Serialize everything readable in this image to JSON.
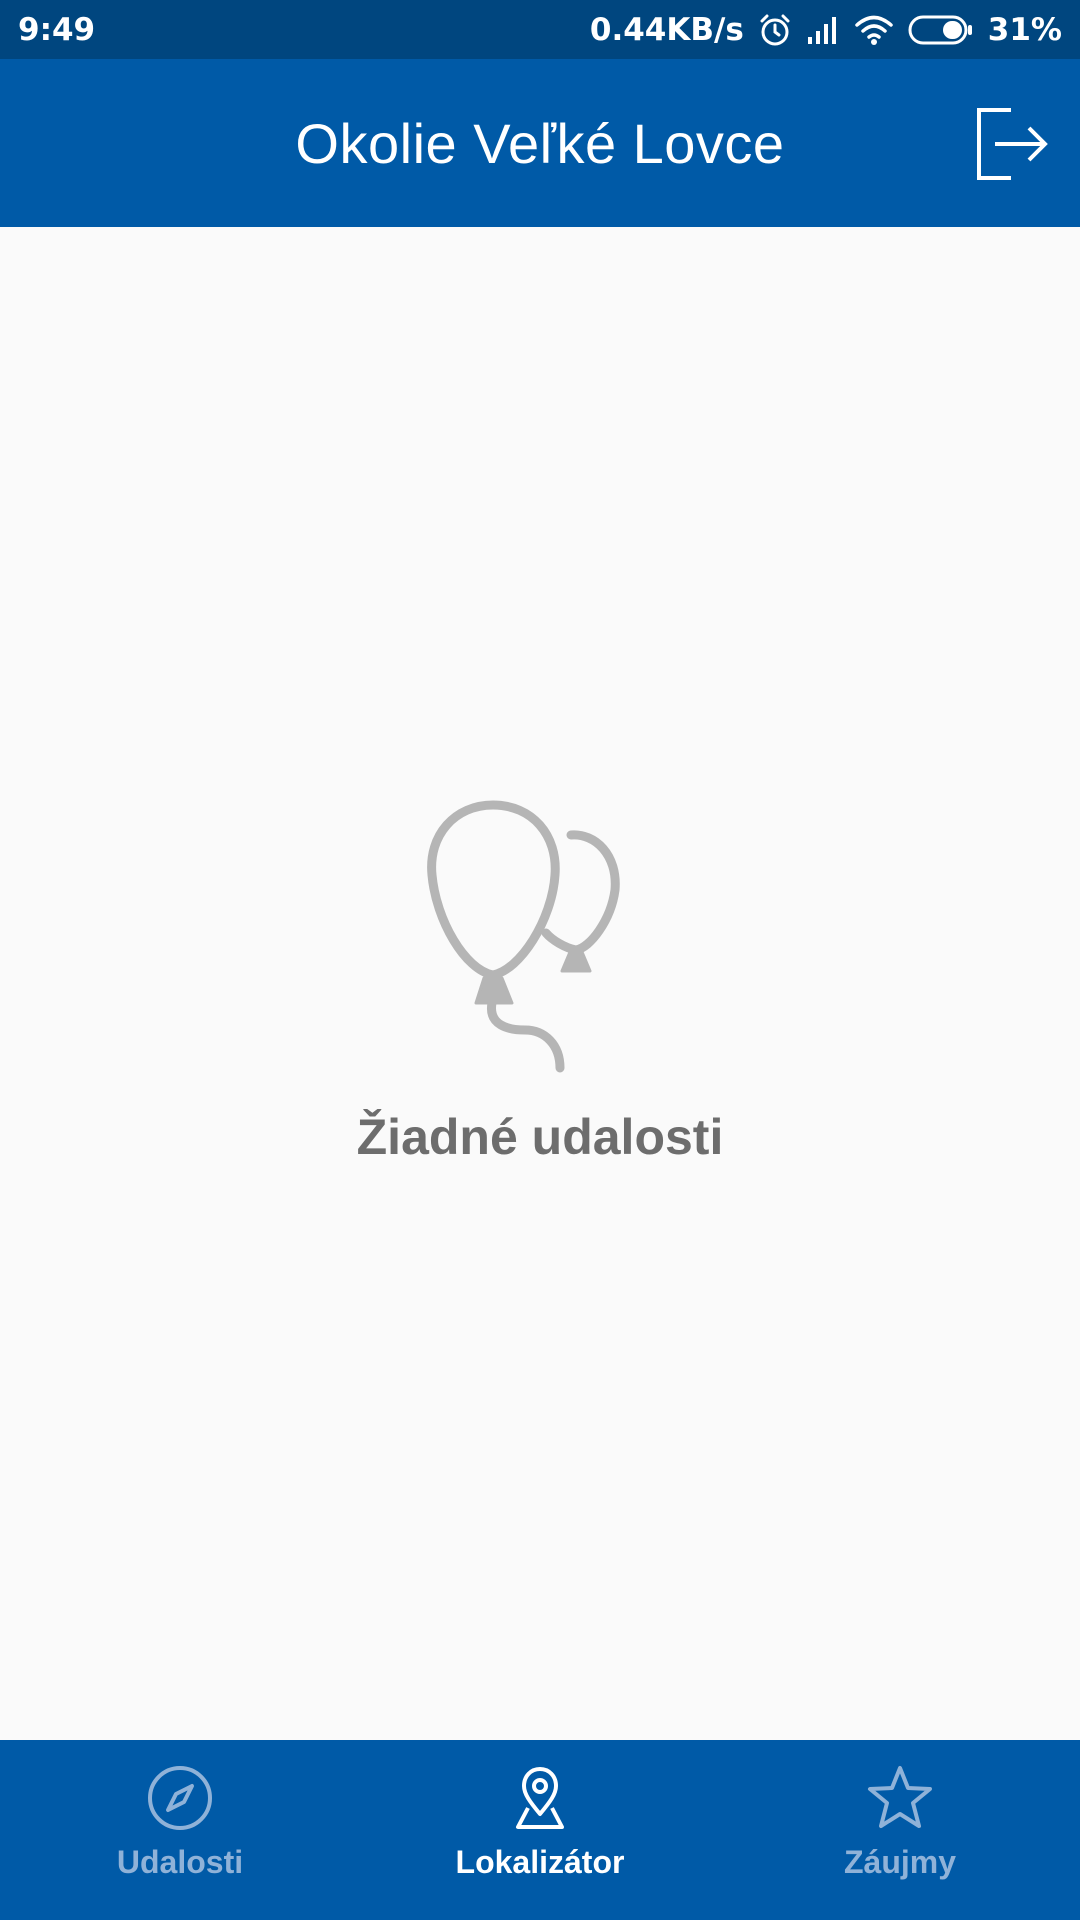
{
  "status_bar": {
    "time": "9:49",
    "network_speed": "0.44KB/s",
    "battery_percent": "31%",
    "icons": [
      "alarm-icon",
      "signal-icon",
      "wifi-icon",
      "battery-icon"
    ]
  },
  "app_bar": {
    "title": "Okolie Veľké Lovce",
    "logout_icon": "logout-icon"
  },
  "empty_state": {
    "icon": "balloons-icon",
    "message": "Žiadné udalosti"
  },
  "bottom_nav": {
    "items": [
      {
        "label": "Udalosti",
        "icon": "compass-icon",
        "active": false
      },
      {
        "label": "Lokalizátor",
        "icon": "map-pin-icon",
        "active": true
      },
      {
        "label": "Záujmy",
        "icon": "star-icon",
        "active": false
      }
    ]
  },
  "colors": {
    "status_bar": "#00467f",
    "primary": "#005aa7",
    "background": "#fafafa",
    "inactive_nav": "#8fb2d8",
    "empty_icon": "#b5b5b5",
    "empty_text": "#6d6d6d"
  }
}
